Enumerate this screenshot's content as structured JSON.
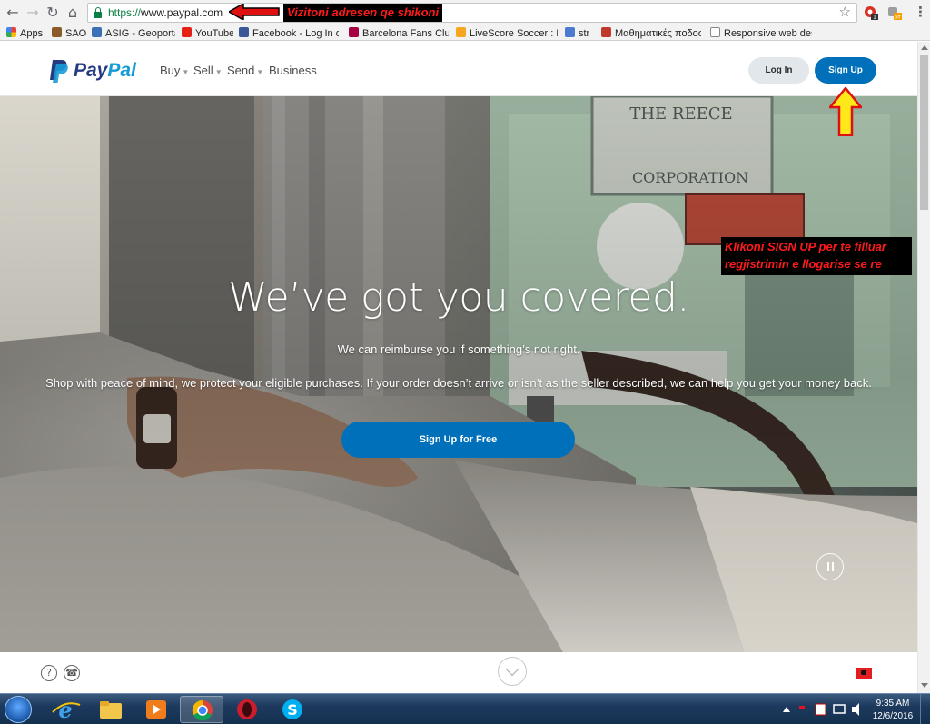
{
  "browser": {
    "url_scheme": "https://",
    "url_host": "www.paypal.com",
    "annotation_address": "Vizitoni adresen qe shikoni",
    "bookmarks": [
      {
        "label": "Apps",
        "color": "#e94235"
      },
      {
        "label": "SAO",
        "color": "#8b5a2b"
      },
      {
        "label": "ASIG - Geoportal",
        "color": "#3b6fb6"
      },
      {
        "label": "YouTube",
        "color": "#e62117"
      },
      {
        "label": "Facebook - Log In or S",
        "color": "#3b5998"
      },
      {
        "label": "Barcelona Fans Club -",
        "color": "#a50044"
      },
      {
        "label": "LiveScore Soccer : Live",
        "color": "#f5a623"
      },
      {
        "label": "str",
        "color": "#4a7bd0"
      },
      {
        "label": "Μαθηματικές ποδοσφ",
        "color": "#c0392b"
      },
      {
        "label": "Responsive web desig",
        "color": "#888888"
      }
    ]
  },
  "paypal": {
    "logo_text_pay": "Pay",
    "logo_text_pal": "Pal",
    "logo_color_dark": "#253b80",
    "logo_color_light": "#179bd7",
    "nav": [
      "Buy",
      "Sell",
      "Send",
      "Business"
    ],
    "login_label": "Log In",
    "signup_label": "Sign Up",
    "primary_color": "#0070ba"
  },
  "hero": {
    "title": "We’ve got you covered.",
    "subtitle": "We can reimburse you if something’s not right.",
    "body": "Shop with peace of mind, we protect your eligible purchases. If your order doesn’t arrive or isn’t as the seller described, we can help you get your money back.",
    "cta_label": "Sign Up for Free",
    "annotation_signup": "Klikoni SIGN UP per te filluar regjistrimin e llogarise se re"
  },
  "footer": {
    "help_icon": "question-icon",
    "phone_icon": "phone-icon",
    "flag_icon": "albania-flag-icon"
  },
  "taskbar": {
    "time": "9:35 AM",
    "date": "12/6/2016",
    "apps": [
      "internet-explorer",
      "file-explorer",
      "media-player",
      "chrome",
      "opera",
      "skype"
    ]
  }
}
